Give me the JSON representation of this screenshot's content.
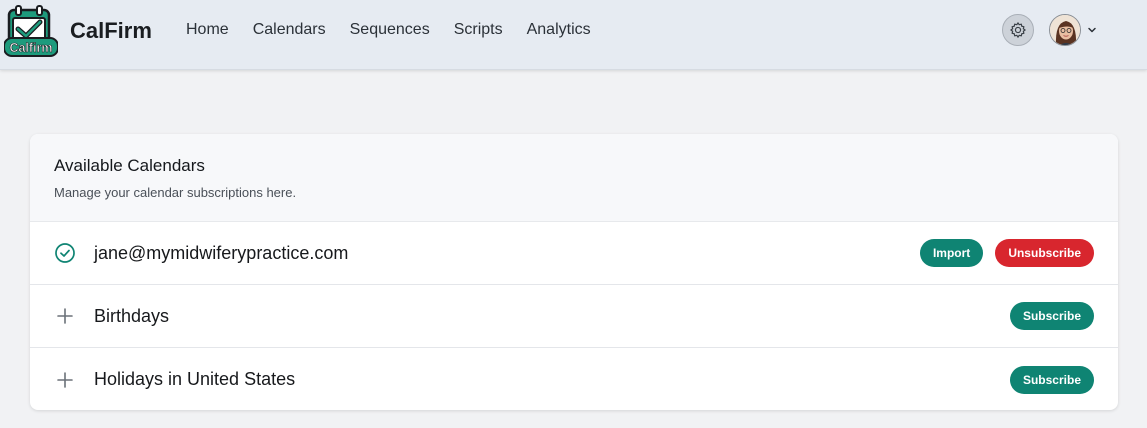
{
  "app": {
    "name": "CalFirm",
    "logo_text": "Calfirm"
  },
  "nav": {
    "items": [
      "Home",
      "Calendars",
      "Sequences",
      "Scripts",
      "Analytics"
    ]
  },
  "header_icons": {
    "settings": "gear-icon",
    "avatar": "user-avatar",
    "dropdown": "chevron-down-icon"
  },
  "card": {
    "title": "Available Calendars",
    "subtitle": "Manage your calendar subscriptions here.",
    "rows": [
      {
        "label": "jane@mymidwiferypractice.com",
        "status": "subscribed",
        "icon": "check-circle-icon",
        "actions": [
          "Import",
          "Unsubscribe"
        ]
      },
      {
        "label": "Birthdays",
        "status": "available",
        "icon": "plus-icon",
        "actions": [
          "Subscribe"
        ]
      },
      {
        "label": "Holidays in United States",
        "status": "available",
        "icon": "plus-icon",
        "actions": [
          "Subscribe"
        ]
      }
    ]
  },
  "colors": {
    "accent_green": "#0f8473",
    "danger_red": "#d8262e",
    "header_bg": "#e6ebf2",
    "page_bg": "#f1f2f4"
  }
}
